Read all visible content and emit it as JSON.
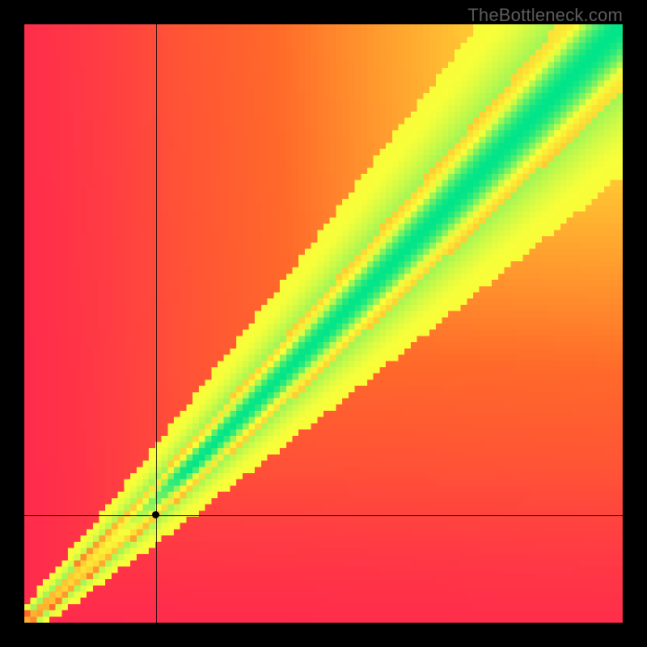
{
  "watermark": "TheBottleneck.com",
  "chart_data": {
    "type": "heatmap",
    "title": "",
    "xlabel": "",
    "ylabel": "",
    "xlim": [
      0,
      1
    ],
    "ylim": [
      0,
      1
    ],
    "grid": false,
    "legend": false,
    "crosshair": {
      "x": 0.22,
      "y": 0.18
    },
    "marker": {
      "x": 0.22,
      "y": 0.18
    },
    "optimal_band": {
      "description": "green diagonal band where x≈y (no bottleneck)",
      "center_slope": 1.0,
      "width_fraction_at_max": 0.18
    },
    "color_stops": [
      {
        "value": 0.0,
        "color": "#ff2b4d",
        "meaning": "severe bottleneck"
      },
      {
        "value": 0.35,
        "color": "#ff6a2a",
        "meaning": "high bottleneck"
      },
      {
        "value": 0.6,
        "color": "#ffcc33",
        "meaning": "moderate"
      },
      {
        "value": 0.8,
        "color": "#f8ff3a",
        "meaning": "mild"
      },
      {
        "value": 1.0,
        "color": "#00e58a",
        "meaning": "balanced"
      }
    ],
    "pixelation": 96
  }
}
